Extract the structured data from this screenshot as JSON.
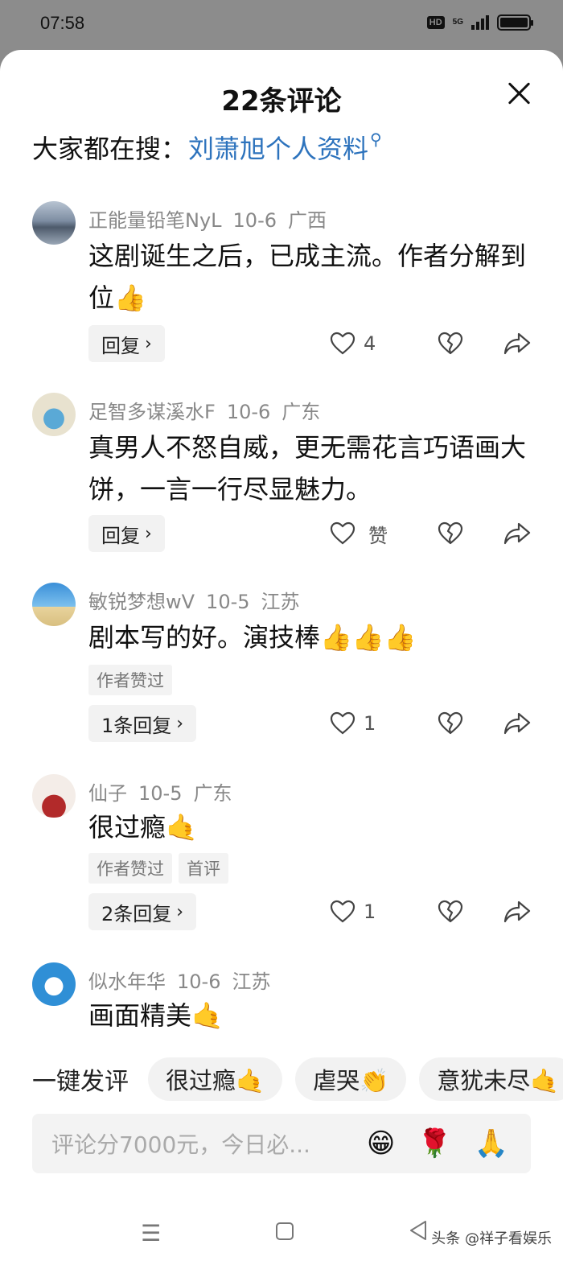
{
  "status": {
    "time": "07:58",
    "hd": "HD",
    "network": "5G"
  },
  "header": {
    "title": "22条评论"
  },
  "search_hint": {
    "label": "大家都在搜：",
    "query": "刘萧旭个人资料"
  },
  "comments": [
    {
      "user": "正能量铅笔NyL",
      "date": "10-6",
      "location": "广西",
      "text": "这剧诞生之后，已成主流。作者分解到位👍",
      "reply_label": "回复",
      "likes": "4",
      "tags": []
    },
    {
      "user": "足智多谋溪水F",
      "date": "10-6",
      "location": "广东",
      "text": "真男人不怒自威，更无需花言巧语画大饼，一言一行尽显魅力。",
      "reply_label": "回复",
      "likes": "赞",
      "tags": []
    },
    {
      "user": "敏锐梦想wV",
      "date": "10-5",
      "location": "江苏",
      "text": "剧本写的好。演技棒👍👍👍",
      "reply_label": "1条回复",
      "likes": "1",
      "tags": [
        "作者赞过"
      ]
    },
    {
      "user": "仙子",
      "date": "10-5",
      "location": "广东",
      "text": "很过瘾🤙",
      "reply_label": "2条回复",
      "likes": "1",
      "tags": [
        "作者赞过",
        "首评"
      ]
    },
    {
      "user": "似水年华",
      "date": "10-6",
      "location": "江苏",
      "text": "画面精美🤙",
      "reply_label": "",
      "likes": "",
      "tags": []
    }
  ],
  "quick_comment": {
    "label": "一键发评",
    "chips": [
      "很过瘾🤙",
      "虐哭👏",
      "意犹未尽🤙"
    ]
  },
  "input": {
    "placeholder": "评论分7000元，今日必...",
    "emojis": [
      "😁",
      "🌹",
      "🙏"
    ]
  },
  "watermark": "头条 @祥子看娱乐",
  "colors": {
    "link": "#2d73bd",
    "meta": "#888888",
    "statusbar": "#8c8c8c"
  },
  "icons": [
    "close-icon",
    "search-icon",
    "heart-icon",
    "broken-heart-icon",
    "share-icon",
    "chevron-right-icon",
    "menu-icon",
    "home-icon",
    "back-icon"
  ]
}
